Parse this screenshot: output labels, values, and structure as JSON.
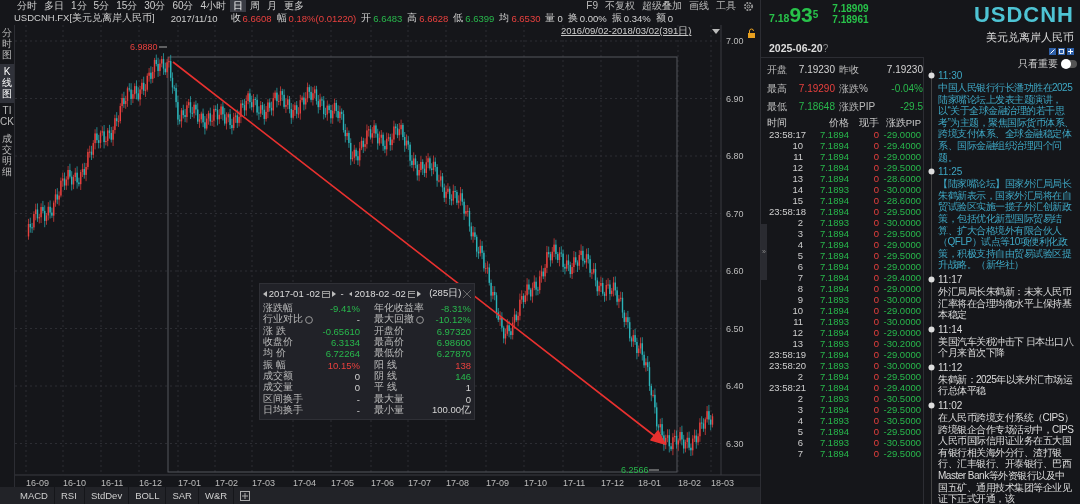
{
  "toolbar": {
    "periods": [
      {
        "label": "分时",
        "selected": false
      },
      {
        "label": "多日",
        "selected": false
      },
      {
        "label": "1分",
        "selected": false
      },
      {
        "label": "5分",
        "selected": false
      },
      {
        "label": "15分",
        "selected": false
      },
      {
        "label": "30分",
        "selected": false
      },
      {
        "label": "60分",
        "selected": false
      },
      {
        "label": "4小时",
        "selected": false
      },
      {
        "label": "日",
        "selected": true
      },
      {
        "label": "周",
        "selected": false
      },
      {
        "label": "月",
        "selected": false
      },
      {
        "label": "更多",
        "selected": false
      }
    ],
    "tools": [
      "F9",
      "不复权",
      "超级叠加",
      "画线",
      "工具"
    ]
  },
  "quote_bar": {
    "symbol": "USDCNH.FX[美元兑离岸人民币]",
    "date": "2017/11/10",
    "fields": [
      {
        "label": "收",
        "value": "6.6608",
        "kind": "up"
      },
      {
        "label": "幅",
        "value": "0.18%(0.01220)",
        "kind": "up"
      },
      {
        "label": "开",
        "value": "6.6483",
        "kind": "down"
      },
      {
        "label": "高",
        "value": "6.6628",
        "kind": "up"
      },
      {
        "label": "低",
        "value": "6.6399",
        "kind": "down"
      },
      {
        "label": "均",
        "value": "6.6530",
        "kind": "up"
      },
      {
        "label": "量",
        "value": "0",
        "kind": "flat"
      },
      {
        "label": "换",
        "value": "0.00%",
        "kind": "flat"
      },
      {
        "label": "振",
        "value": "0.34%",
        "kind": "flat"
      },
      {
        "label": "额",
        "value": "0",
        "kind": "flat"
      }
    ]
  },
  "side_tabs": [
    {
      "label": "分时图",
      "selected": false
    },
    {
      "label": "K线图",
      "selected": true
    },
    {
      "label": "TICK",
      "selected": false
    },
    {
      "label": "成交明细",
      "selected": false
    }
  ],
  "chart": {
    "range": "2016/09/02-2018/03/02(391日)",
    "y_axis": [
      "7.00",
      "6.90",
      "6.80",
      "6.70",
      "6.60",
      "6.50",
      "6.40",
      "6.30"
    ],
    "x_axis": [
      "16-09",
      "16-10",
      "16-11",
      "16-12",
      "17-01",
      "17-02",
      "17-03",
      "17-04",
      "17-05",
      "17-06",
      "17-07",
      "17-08",
      "17-09",
      "17-10",
      "17-11",
      "17-12",
      "18-01",
      "18-02",
      "18-03"
    ],
    "high_marker": "6.9880",
    "low_marker": "6.2566"
  },
  "stats_popup": {
    "start": "2017-01 -02",
    "separator": "-",
    "end": "2018-02 -02",
    "days": "(285日)",
    "cells": [
      {
        "label": "涨跌幅",
        "value": "-9.41%",
        "kind": "down",
        "help": false
      },
      {
        "label": "年化收益率",
        "value": "-8.31%",
        "kind": "down",
        "help": false
      },
      {
        "label": "行业对比",
        "value": "-",
        "kind": "flat",
        "help": true
      },
      {
        "label": "最大回撤",
        "value": "-10.12%",
        "kind": "down",
        "help": true
      },
      {
        "label": "涨 跌",
        "value": "-0.65610",
        "kind": "down",
        "help": false
      },
      {
        "label": "开盘价",
        "value": "6.97320",
        "kind": "down",
        "help": false
      },
      {
        "label": "收盘价",
        "value": "6.3134",
        "kind": "down",
        "help": false
      },
      {
        "label": "最高价",
        "value": "6.98600",
        "kind": "down",
        "help": false
      },
      {
        "label": "均 价",
        "value": "6.72264",
        "kind": "down",
        "help": false
      },
      {
        "label": "最低价",
        "value": "6.27870",
        "kind": "down",
        "help": false
      },
      {
        "label": "振 幅",
        "value": "10.15%",
        "kind": "up",
        "help": false
      },
      {
        "label": "阳 线",
        "value": "138",
        "kind": "up",
        "help": false
      },
      {
        "label": "成交额",
        "value": "0",
        "kind": "flat",
        "help": false
      },
      {
        "label": "阴 线",
        "value": "146",
        "kind": "down",
        "help": false
      },
      {
        "label": "成交量",
        "value": "0",
        "kind": "flat",
        "help": false
      },
      {
        "label": "平 线",
        "value": "1",
        "kind": "flat",
        "help": false
      },
      {
        "label": "区间换手",
        "value": "-",
        "kind": "flat",
        "help": false
      },
      {
        "label": "最大量",
        "value": "0",
        "kind": "flat",
        "help": false
      },
      {
        "label": "日均换手",
        "value": "-",
        "kind": "flat",
        "help": false
      },
      {
        "label": "最小量",
        "value": "100.00亿",
        "kind": "flat",
        "help": false
      }
    ]
  },
  "indicator_tabs": [
    "MACD",
    "RSI",
    "StdDev",
    "BOLL",
    "SAR",
    "W&R"
  ],
  "quote": {
    "price_main": "7.18",
    "price_big": "93",
    "price_sup": "5",
    "bid": "7.18909",
    "ask": "7.18961",
    "symbol": "USDCNH",
    "name": "美元兑离岸人民币",
    "date": "2025-06-20",
    "date_hint": "?"
  },
  "summary": [
    {
      "label": "开盘",
      "value": "7.19230",
      "kind": "flat"
    },
    {
      "label": "昨收",
      "value": "7.19230",
      "kind": "flat"
    },
    {
      "label": "最高",
      "value": "7.19290",
      "kind": "up"
    },
    {
      "label": "涨跌%",
      "value": "-0.04%",
      "kind": "down"
    },
    {
      "label": "最低",
      "value": "7.18648",
      "kind": "down"
    },
    {
      "label": "涨跌PIP",
      "value": "-29.5",
      "kind": "down"
    }
  ],
  "collapse_handle": "»",
  "trades": {
    "columns": [
      "时间",
      "价格",
      "现手",
      "涨跌PIP"
    ],
    "rows": [
      {
        "time": "23:58:17",
        "price": "7.1894",
        "volume": "0",
        "change": "-29.0000"
      },
      {
        "time": "10",
        "price": "7.1894",
        "volume": "0",
        "change": "-29.4000"
      },
      {
        "time": "11",
        "price": "7.1894",
        "volume": "0",
        "change": "-29.0000"
      },
      {
        "time": "12",
        "price": "7.1894",
        "volume": "0",
        "change": "-29.5000"
      },
      {
        "time": "13",
        "price": "7.1894",
        "volume": "0",
        "change": "-28.6000"
      },
      {
        "time": "14",
        "price": "7.1893",
        "volume": "0",
        "change": "-30.0000"
      },
      {
        "time": "15",
        "price": "7.1894",
        "volume": "0",
        "change": "-28.6000"
      },
      {
        "time": "23:58:18",
        "price": "7.1894",
        "volume": "0",
        "change": "-29.5000"
      },
      {
        "time": "2",
        "price": "7.1893",
        "volume": "0",
        "change": "-30.0000"
      },
      {
        "time": "3",
        "price": "7.1894",
        "volume": "0",
        "change": "-29.5000"
      },
      {
        "time": "4",
        "price": "7.1894",
        "volume": "0",
        "change": "-29.0000"
      },
      {
        "time": "5",
        "price": "7.1894",
        "volume": "0",
        "change": "-29.5000"
      },
      {
        "time": "6",
        "price": "7.1894",
        "volume": "0",
        "change": "-29.0000"
      },
      {
        "time": "7",
        "price": "7.1894",
        "volume": "0",
        "change": "-29.4000"
      },
      {
        "time": "8",
        "price": "7.1894",
        "volume": "0",
        "change": "-29.0000"
      },
      {
        "time": "9",
        "price": "7.1893",
        "volume": "0",
        "change": "-30.0000"
      },
      {
        "time": "10",
        "price": "7.1894",
        "volume": "0",
        "change": "-29.0000"
      },
      {
        "time": "11",
        "price": "7.1893",
        "volume": "0",
        "change": "-30.0000"
      },
      {
        "time": "12",
        "price": "7.1894",
        "volume": "0",
        "change": "-29.0000"
      },
      {
        "time": "13",
        "price": "7.1893",
        "volume": "0",
        "change": "-30.2000"
      },
      {
        "time": "23:58:19",
        "price": "7.1894",
        "volume": "0",
        "change": "-29.0000"
      },
      {
        "time": "23:58:20",
        "price": "7.1893",
        "volume": "0",
        "change": "-30.0000"
      },
      {
        "time": "2",
        "price": "7.1894",
        "volume": "0",
        "change": "-29.5000"
      },
      {
        "time": "23:58:21",
        "price": "7.1894",
        "volume": "0",
        "change": "-29.4000"
      },
      {
        "time": "2",
        "price": "7.1893",
        "volume": "0",
        "change": "-30.5000"
      },
      {
        "time": "3",
        "price": "7.1894",
        "volume": "0",
        "change": "-29.5000"
      },
      {
        "time": "4",
        "price": "7.1893",
        "volume": "0",
        "change": "-30.5000"
      },
      {
        "time": "5",
        "price": "7.1894",
        "volume": "0",
        "change": "-29.5000"
      },
      {
        "time": "6",
        "price": "7.1893",
        "volume": "0",
        "change": "-30.5000"
      },
      {
        "time": "7",
        "price": "7.1894",
        "volume": "0",
        "change": "-29.5000"
      }
    ]
  },
  "news": {
    "filter_label": "只看重要",
    "filter_on": false,
    "items": [
      {
        "time": "11:30",
        "text": "中国人民银行行长潘功胜在2025陆家嘴论坛上发表主题演讲，以“关于全球金融治理的若干思考”为主题，聚焦国际货币体系、跨境支付体系、全球金融稳定体系、国际金融组织治理四个问题。",
        "highlighted": true
      },
      {
        "time": "11:25",
        "text": "【陆家嘴论坛】国家外汇局局长朱鹤新表示，国家外汇局将在自贸试验区实施一揽子外汇创新政策，包括优化新型国际贸易结算、扩大合格境外有限合伙人（QFLP）试点等10项便利化政策，积极支持自由贸易试验区提升战略。（新华社）",
        "highlighted": true
      },
      {
        "time": "11:17",
        "text": "外汇局局长朱鹤新：未来人民币汇率将在合理均衡水平上保持基本稳定",
        "highlighted": false
      },
      {
        "time": "11:14",
        "text": "美国汽车关税冲击下 日本出口八个月来首次下降",
        "highlighted": false
      },
      {
        "time": "11:12",
        "text": "朱鹤新：2025年以来外汇市场运行总体平稳",
        "highlighted": false
      },
      {
        "time": "11:02",
        "text": "在人民币跨境支付系统（CIPS）跨境银企合作专场活动中，CIPS人民币国际信用证业务在五大国有银行相关海外分行、渣打银行、汇丰银行、开泰银行、巴西Master Bank等外资银行以及中国五矿、通用技术集团等企业见证下正式开通，该",
        "highlighted": false
      }
    ]
  }
}
